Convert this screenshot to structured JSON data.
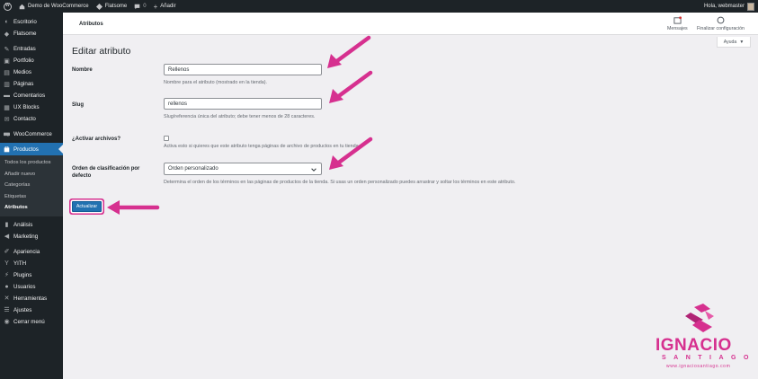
{
  "adminbar": {
    "site_name": "Demo de WooCommerce",
    "theme_name": "Flatsome",
    "comments_count": "0",
    "new_label": "Añadir",
    "greeting": "Hola, webmaster"
  },
  "sidebar": {
    "items_top": [
      {
        "label": "Escritorio",
        "icon": "dashboard-icon"
      },
      {
        "label": "Flatsome",
        "icon": "flatsome-icon"
      }
    ],
    "items_mid": [
      {
        "label": "Entradas",
        "icon": "pin-icon"
      },
      {
        "label": "Portfolio",
        "icon": "portfolio-icon"
      },
      {
        "label": "Medios",
        "icon": "media-icon"
      },
      {
        "label": "Páginas",
        "icon": "pages-icon"
      },
      {
        "label": "Comentarios",
        "icon": "comments-icon"
      },
      {
        "label": "UX Blocks",
        "icon": "blocks-icon"
      },
      {
        "label": "Contacto",
        "icon": "mail-icon"
      }
    ],
    "woocommerce": "WooCommerce",
    "current": "Productos",
    "submenu": [
      "Todos los productos",
      "Añadir nuevo",
      "Categorías",
      "Etiquetas",
      "Atributos"
    ],
    "items_bottom": [
      {
        "label": "Análisis",
        "icon": "chart-icon"
      },
      {
        "label": "Marketing",
        "icon": "megaphone-icon"
      }
    ],
    "items_tail": [
      {
        "label": "Apariencia",
        "icon": "brush-icon"
      },
      {
        "label": "YITH",
        "icon": "yith-icon"
      },
      {
        "label": "Plugins",
        "icon": "plugin-icon"
      },
      {
        "label": "Usuarios",
        "icon": "users-icon"
      },
      {
        "label": "Herramientas",
        "icon": "wrench-icon"
      },
      {
        "label": "Ajustes",
        "icon": "settings-icon"
      },
      {
        "label": "Cerrar menú",
        "icon": "collapse-icon"
      }
    ]
  },
  "header": {
    "breadcrumb": "Atributos",
    "messages_label": "Mensajes",
    "finish_label": "Finalizar configuración",
    "help_label": "Ayuda"
  },
  "form": {
    "title": "Editar atributo",
    "name_label": "Nombre",
    "name_value": "Rellenos",
    "name_desc": "Nombre para el atributo (mostrado en la tienda).",
    "slug_label": "Slug",
    "slug_value": "rellenos",
    "slug_desc": "Slug/referencia única del atributo; debe tener menos de 28 caracteres.",
    "archive_label": "¿Activar archivos?",
    "archive_desc": "Activa esto si quieres que este atributo tenga páginas de archivo de productos en tu tienda.",
    "order_label_1": "Orden de clasificación por",
    "order_label_2": "defecto",
    "order_value": "Orden personalizado",
    "order_desc": "Determina el orden de los términos en las páginas de productos de la tienda. Si usas un orden personalizado puedes arrastrar y soltar los términos en este atributo.",
    "submit_label": "Actualizar"
  },
  "watermark": {
    "name": "IGNACIO",
    "surname": "SANTIAGO",
    "url": "www.ignaciosantiago.com"
  },
  "colors": {
    "accent": "#2271b1",
    "sidebar_bg": "#1d2327",
    "arrow": "#d6308f"
  }
}
